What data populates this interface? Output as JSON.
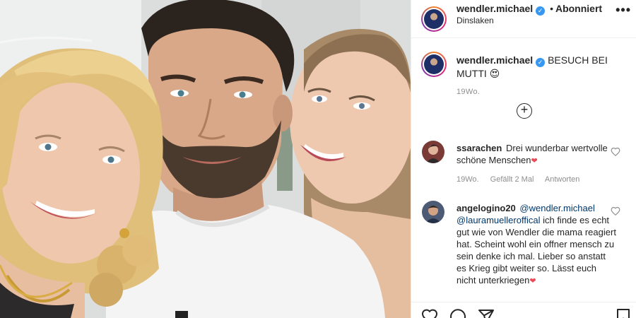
{
  "post": {
    "author": "wendler.michael",
    "verified_label": "✓",
    "separator": "•",
    "follow_status": "Abonniert",
    "location": "Dinslaken",
    "more_label": "•••",
    "caption": {
      "text": "BESUCH BEI MUTTI",
      "emoji": "😍"
    },
    "timestamp": "19Wo.",
    "load_more_label": "+"
  },
  "comments": [
    {
      "username": "ssarachen",
      "text": "Drei wunderbar wertvolle schöne Menschen",
      "emoji": "❤",
      "time": "19Wo.",
      "likes": "Gefällt 2 Mal",
      "reply": "Antworten"
    },
    {
      "username": "angelogino20",
      "mention1": "@wendler.michael",
      "mention2": "@lauramuelleroffical",
      "text": "ich finde es echt gut wie von Wendler die mama reagiert hat. Scheint wohl ein offner mensch zu sein denke ich mal. Lieber so anstatt es Krieg gibt weiter so. Lässt euch nicht unterkriegen",
      "emoji": "❤"
    }
  ],
  "icons": {
    "like": "heart-icon",
    "comment": "comment-icon",
    "share": "paper-plane-icon",
    "save": "bookmark-icon",
    "verified": "verified-badge-icon"
  },
  "colors": {
    "link": "#00376b",
    "verified": "#3897f0",
    "muted": "#8e8e8e",
    "heart": "#ed4956"
  }
}
